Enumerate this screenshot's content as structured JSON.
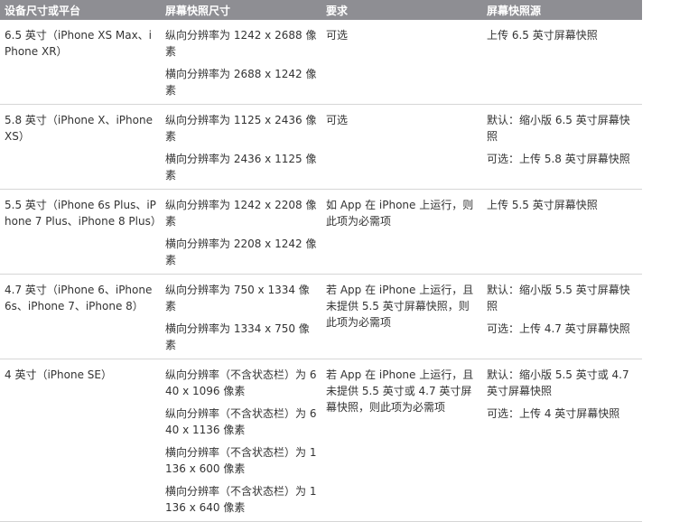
{
  "headers": [
    "设备尺寸或平台",
    "屏幕快照尺寸",
    "要求",
    "屏幕快照源"
  ],
  "rows": [
    {
      "device": "6.5 英寸（iPhone XS Max、iPhone XR）",
      "sizes": [
        "纵向分辨率为 1242 x 2688 像素",
        "横向分辨率为 2688 x 1242 像素"
      ],
      "requirement": "可选",
      "sources": [
        "上传 6.5 英寸屏幕快照"
      ]
    },
    {
      "device": "5.8 英寸（iPhone X、iPhone XS）",
      "sizes": [
        "纵向分辨率为 1125 x 2436 像素",
        "横向分辨率为 2436 x 1125 像素"
      ],
      "requirement": "可选",
      "sources": [
        "默认：缩小版 6.5 英寸屏幕快照",
        "可选：上传 5.8 英寸屏幕快照"
      ]
    },
    {
      "device": "5.5 英寸（iPhone 6s Plus、iPhone 7 Plus、iPhone 8 Plus）",
      "sizes": [
        "纵向分辨率为 1242 x 2208 像素",
        "横向分辨率为 2208 x 1242 像素"
      ],
      "requirement": "如 App 在 iPhone 上运行，则此项为必需项",
      "sources": [
        "上传 5.5 英寸屏幕快照"
      ]
    },
    {
      "device": "4.7 英寸（iPhone 6、iPhone 6s、iPhone 7、iPhone 8）",
      "sizes": [
        "纵向分辨率为 750 x 1334 像素",
        "横向分辨率为 1334 x 750 像素"
      ],
      "requirement": "若 App 在 iPhone 上运行，且未提供 5.5 英寸屏幕快照，则此项为必需项",
      "sources": [
        "默认：缩小版 5.5 英寸屏幕快照",
        "可选：上传 4.7 英寸屏幕快照"
      ]
    },
    {
      "device": "4 英寸（iPhone SE）",
      "sizes": [
        "纵向分辨率（不含状态栏）为 640 x 1096 像素",
        "纵向分辨率（不含状态栏）为 640 x 1136 像素",
        "横向分辨率（不含状态栏）为 1136 x 600 像素",
        "横向分辨率（不含状态栏）为 1136 x 640 像素"
      ],
      "requirement": "若 App 在 iPhone 上运行，且未提供 5.5 英寸或 4.7 英寸屏幕快照，则此项为必需项",
      "sources": [
        "默认：缩小版 5.5 英寸或 4.7 英寸屏幕快照",
        "可选：上传 4 英寸屏幕快照"
      ]
    }
  ]
}
